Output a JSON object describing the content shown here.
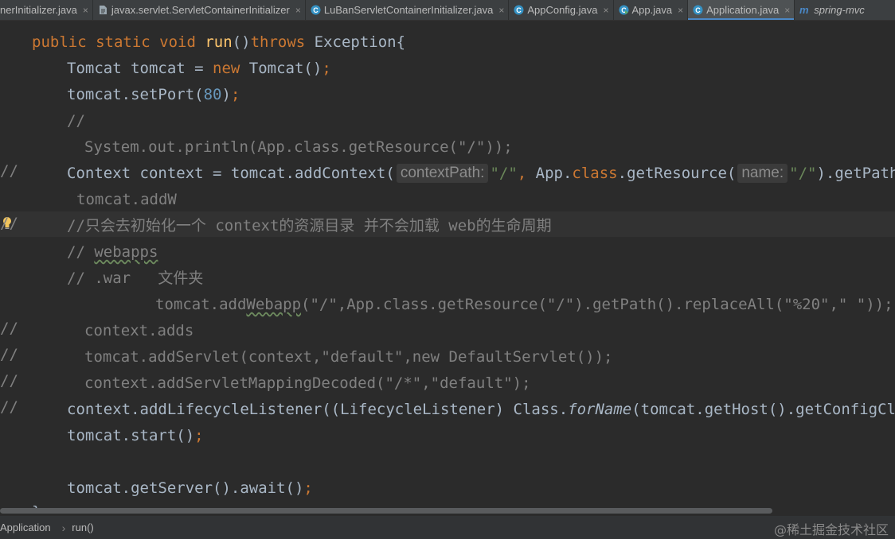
{
  "tabs": [
    {
      "label": "nerInitializer.java",
      "icon": "java-file-icon",
      "close": "×",
      "active": false
    },
    {
      "label": "javax.servlet.ServletContainerInitializer",
      "icon": "text-file-icon",
      "close": "×",
      "active": false
    },
    {
      "label": "LuBanServletContainerInitializer.java",
      "icon": "class-icon",
      "close": "×",
      "active": false
    },
    {
      "label": "AppConfig.java",
      "icon": "class-icon",
      "close": "×",
      "active": false
    },
    {
      "label": "App.java",
      "icon": "runnable-class-icon",
      "close": "×",
      "active": false
    },
    {
      "label": "Application.java",
      "icon": "class-icon",
      "close": "×",
      "active": true
    },
    {
      "label": "spring-mvc",
      "icon": "module-icon",
      "close": "",
      "active": false
    }
  ],
  "colors": {
    "background": "#2b2b2b",
    "keyword": "#cc7832",
    "method_decl": "#ffc66d",
    "number": "#6897bb",
    "string": "#6a8759",
    "comment": "#808080",
    "default_text": "#a9b7c6",
    "active_tab_underline": "#4a88c7"
  },
  "code": {
    "l1": {
      "kw1": "public static void ",
      "fn": "run",
      "p": "()",
      "kw2": "throws",
      "rest": " Exception{"
    },
    "l2": {
      "a": "Tomcat tomcat = ",
      "kw": "new",
      "b": " Tomcat()",
      "semi": ";"
    },
    "l3": {
      "a": "tomcat.setPort(",
      "num": "80",
      "b": ")",
      "semi": ";"
    },
    "l4": {
      "cm": "//"
    },
    "l5": {
      "gutter": "//",
      "cm": "System.out.println(App.class.getResource(\"/\"));"
    },
    "l6": {
      "a": "Context context = tomcat.addContext(",
      "hint1": "contextPath:",
      "s1": "\"/\"",
      "comma": ",",
      "b": " App.",
      "kw": "class",
      "c": ".getResource(",
      "hint2": "name:",
      "s2": "\"/\"",
      "d": ").getPath"
    },
    "l7": {
      "gutter": "//",
      "cm": "tomcat.addW"
    },
    "l8": {
      "cm": "//只会去初始化一个 context的资源目录 并不会加载 web的生命周期"
    },
    "l9": {
      "a": "// ",
      "w": "webapps"
    },
    "l10": {
      "cm": "// .war   文件夹"
    },
    "l11": {
      "gutter": "//",
      "a": "tomcat.add",
      "w": "Webapp",
      "b": "(\"/\",App.class.getResource(\"/\").getPath().replaceAll(\"%20\",\" \"));"
    },
    "l12": {
      "gutter": "//",
      "cm": "context.adds"
    },
    "l13": {
      "gutter": "//",
      "cm": "tomcat.addServlet(context,\"default\",new DefaultServlet());"
    },
    "l14": {
      "gutter": "//",
      "cm": "context.addServletMappingDecoded(\"/*\",\"default\");"
    },
    "l15": {
      "a": "context.addLifecycleListener((LifecycleListener) Class.",
      "it": "forName",
      "b": "(tomcat.getHost().getConfigClass("
    },
    "l16": {
      "a": "tomcat.start()",
      "semi": ";"
    },
    "l17": {
      "a": "tomcat.getServer().await()",
      "semi": ";"
    },
    "l18": {
      "a": "}"
    }
  },
  "breadcrumb": {
    "items": [
      "Application",
      "run()"
    ],
    "separator": "›"
  },
  "watermark": "@稀土掘金技术社区"
}
